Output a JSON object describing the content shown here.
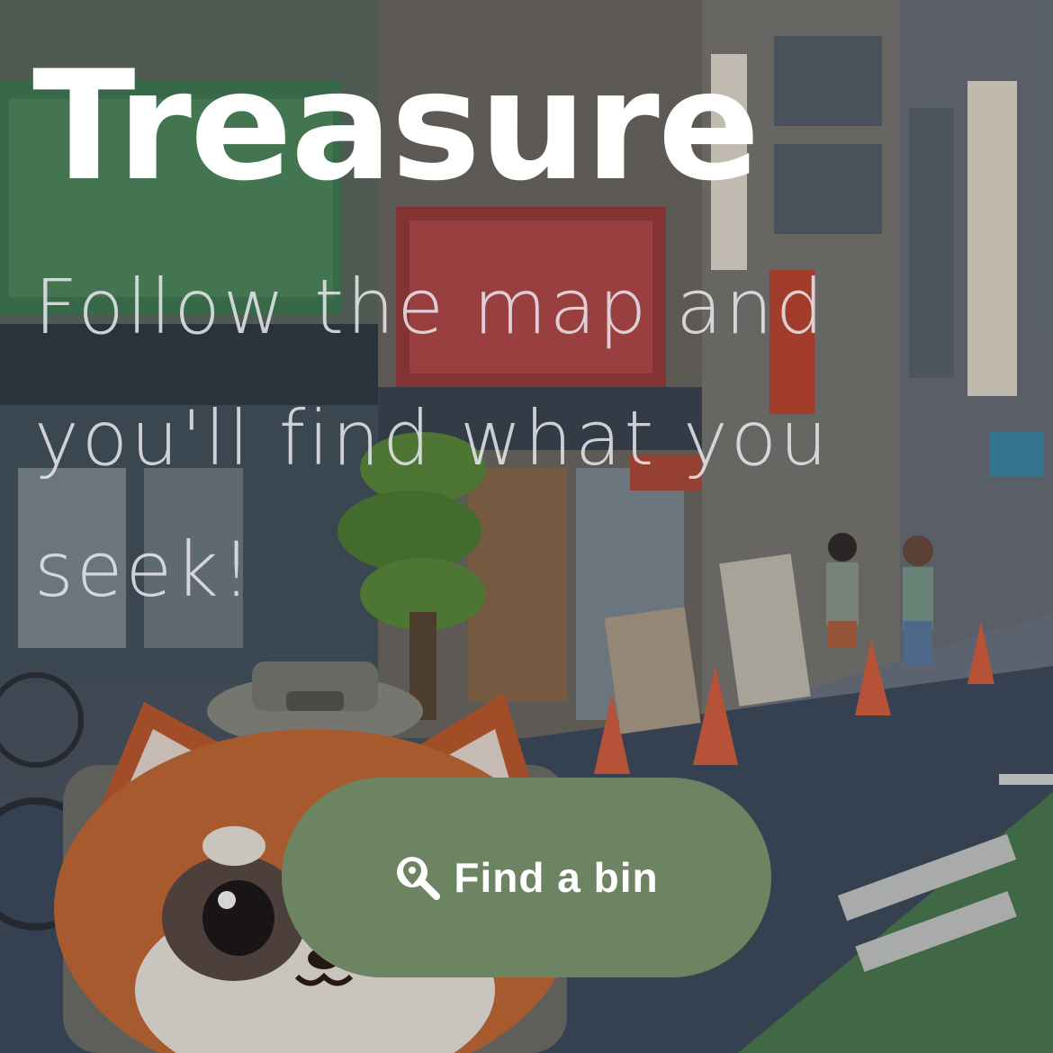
{
  "hero": {
    "title": "Treasure",
    "subtitle": "Follow the map and you'll find what you seek!"
  },
  "cta": {
    "label": "Find a bin",
    "icon": "search-location-icon"
  },
  "colors": {
    "button_bg": "#6c8462",
    "title": "#ffffff",
    "subtitle": "#e8e8ec"
  },
  "illustration": {
    "subject": "red-panda-in-trash-bin",
    "scene": "japanese-street"
  }
}
